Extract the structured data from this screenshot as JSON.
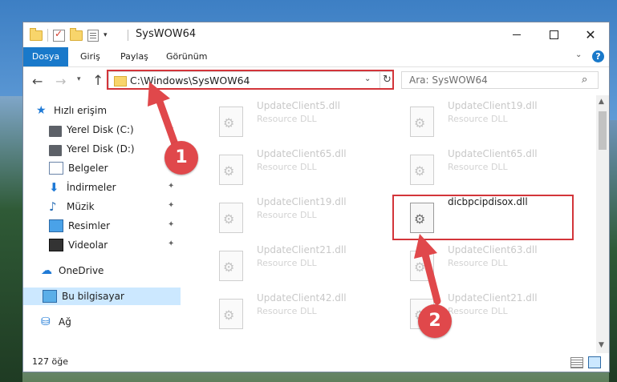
{
  "window": {
    "title": "SysWOW64",
    "minimize": "—",
    "maximize": "☐",
    "close": "✕"
  },
  "ribbon": {
    "tabs": [
      "Dosya",
      "Giriş",
      "Paylaş",
      "Görünüm"
    ],
    "expand_icon": "chevron-down-icon",
    "help": "?"
  },
  "address_bar": {
    "path": "C:\\Windows\\SysWOW64",
    "search_placeholder": "Ara: SysWOW64"
  },
  "sidebar": {
    "items": [
      {
        "label": "Hızlı erişim",
        "icon": "star-icon"
      },
      {
        "label": "Yerel Disk (C:)",
        "icon": "drive-icon"
      },
      {
        "label": "Yerel Disk (D:)",
        "icon": "drive-icon"
      },
      {
        "label": "Belgeler",
        "icon": "documents-icon"
      },
      {
        "label": "İndirmeler",
        "icon": "download-icon"
      },
      {
        "label": "Müzik",
        "icon": "music-icon"
      },
      {
        "label": "Resimler",
        "icon": "pictures-icon"
      },
      {
        "label": "Videolar",
        "icon": "videos-icon"
      },
      {
        "label": "OneDrive",
        "icon": "cloud-icon"
      },
      {
        "label": "Bu bilgisayar",
        "icon": "computer-icon"
      },
      {
        "label": "Ağ",
        "icon": "network-icon"
      }
    ]
  },
  "files": [
    {
      "name": "UpdateClient5.dll",
      "type": "Resource DLL"
    },
    {
      "name": "UpdateClient19.dll",
      "type": "Resource DLL"
    },
    {
      "name": "UpdateClient65.dll",
      "type": "Resource DLL"
    },
    {
      "name": "UpdateClient65.dll",
      "type": "Resource DLL"
    },
    {
      "name": "UpdateClient19.dll",
      "type": "Resource DLL"
    },
    {
      "name": "dicbpcipdisox.dll",
      "type": ""
    },
    {
      "name": "UpdateClient21.dll",
      "type": "Resource DLL"
    },
    {
      "name": "UpdateClient63.dll",
      "type": "Resource DLL"
    },
    {
      "name": "UpdateClient42.dll",
      "type": "Resource DLL"
    },
    {
      "name": "UpdateClient21.dll",
      "type": "Resource DLL"
    }
  ],
  "status": {
    "item_count": "127 öğe"
  },
  "annotations": {
    "marker_1": "1",
    "marker_2": "2",
    "color": "#d3353a"
  }
}
